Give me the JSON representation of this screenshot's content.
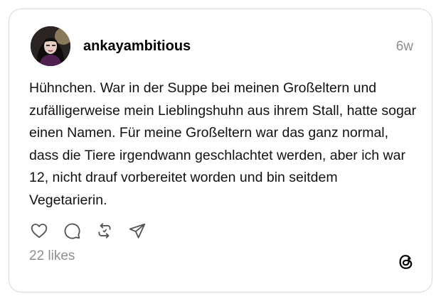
{
  "post": {
    "username": "ankayambitious",
    "time": "6w",
    "text": "Hühnchen. War in der Suppe bei meinen Großeltern und zufälligerweise mein Lieblingshuhn aus ihrem Stall, hatte sogar einen Namen. Für meine Großeltern war das ganz normal, dass die Tiere irgendwann geschlachtet werden, aber ich war 12, nicht drauf vorbereitet worden und bin seitdem Vegetarierin.",
    "likes": "22 likes"
  },
  "icons": {
    "like": "heart-icon",
    "reply": "comment-icon",
    "repost": "repost-icon",
    "share": "send-icon",
    "brand": "threads-logo-icon"
  },
  "colors": {
    "text": "#111111",
    "muted": "#8e8e8e",
    "border": "#d9d9d9",
    "icon": "#555555"
  }
}
